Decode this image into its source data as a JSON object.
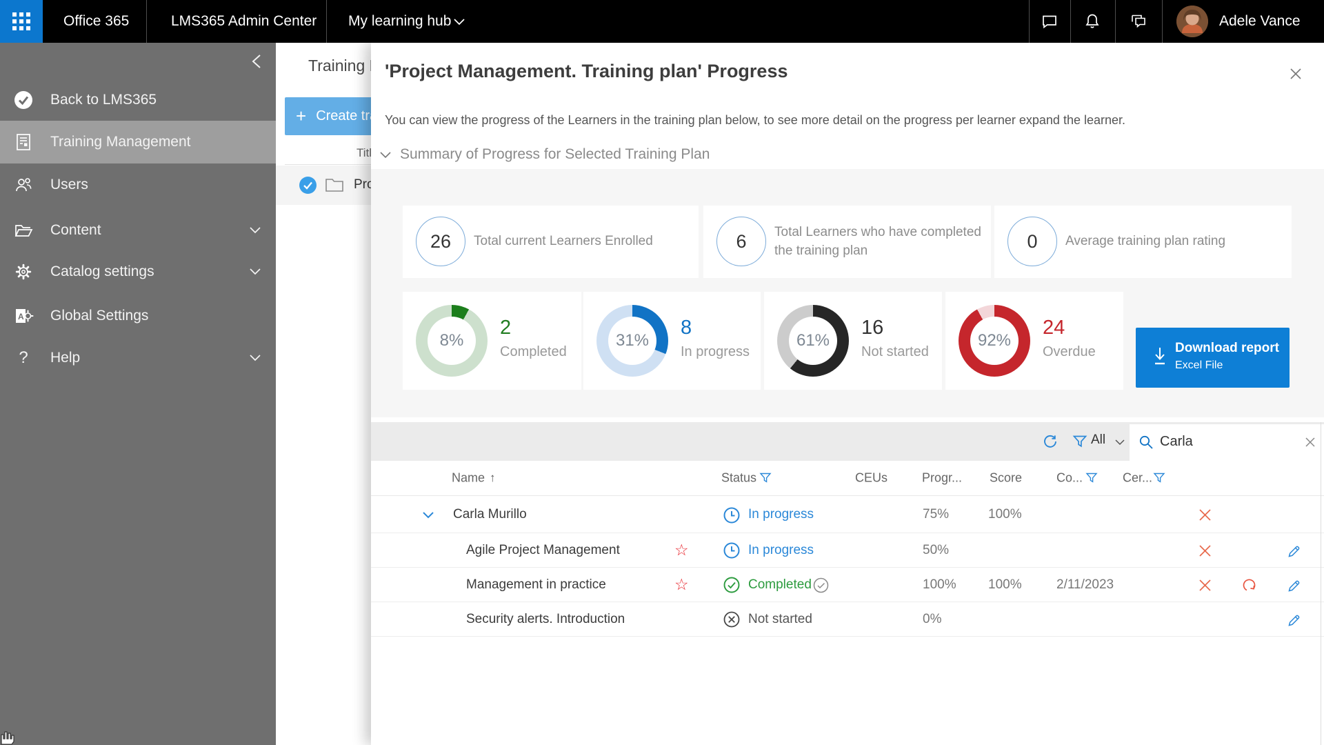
{
  "topbar": {
    "brand": "Office 365",
    "app": "LMS365 Admin Center",
    "hub": "My learning hub",
    "user": "Adele Vance"
  },
  "sidebar": {
    "items": [
      {
        "label": "Back to LMS365"
      },
      {
        "label": "Training Management"
      },
      {
        "label": "Users"
      },
      {
        "label": "Content"
      },
      {
        "label": "Catalog settings"
      },
      {
        "label": "Global Settings"
      },
      {
        "label": "Help"
      }
    ]
  },
  "background_page": {
    "title": "Training M",
    "create_button_plus": "+",
    "create_button": "Create tra",
    "column_header": "Titl",
    "row_label": "Pro"
  },
  "overlay": {
    "title": "'Project Management. Training plan' Progress",
    "description": "You can view the progress of the Learners in the training plan below, to see more detail on the progress per learner expand the learner.",
    "summary_heading": "Summary of Progress for Selected Training Plan",
    "stats": [
      {
        "value": "26",
        "label": "Total current Learners Enrolled"
      },
      {
        "value": "6",
        "label": "Total Learners who have completed the training plan"
      },
      {
        "value": "0",
        "label": "Average training plan rating"
      }
    ],
    "donuts": [
      {
        "pct": "8%",
        "pct_value": 8,
        "count": "2",
        "label": "Completed",
        "arc": "#1c7e1c",
        "track": "#cde0cd",
        "count_color": "#217d21"
      },
      {
        "pct": "31%",
        "pct_value": 31,
        "count": "8",
        "label": "In progress",
        "arc": "#1173c5",
        "track": "#cfe0f3",
        "count_color": "#1173c5"
      },
      {
        "pct": "61%",
        "pct_value": 61,
        "count": "16",
        "label": "Not started",
        "arc": "#262626",
        "track": "#cccccc",
        "count_color": "#333333"
      },
      {
        "pct": "92%",
        "pct_value": 92,
        "count": "24",
        "label": "Overdue",
        "arc": "#c5262c",
        "track": "#f3d6d9",
        "count_color": "#c5262c"
      }
    ],
    "download": {
      "title": "Download report",
      "subtitle": "Excel File"
    },
    "toolbar": {
      "filter_value": "All",
      "search_value": "Carla"
    },
    "table": {
      "columns": [
        "Name",
        "Status",
        "CEUs",
        "Progr...",
        "Score",
        "Co...",
        "Cer..."
      ],
      "sort_arrow": "↑",
      "rows": [
        {
          "name": "Carla Murillo",
          "status": "In progress",
          "progress": "75%",
          "score": "100%",
          "completion": ""
        },
        {
          "name": "Agile Project Management",
          "status": "In progress",
          "progress": "50%",
          "score": "",
          "completion": ""
        },
        {
          "name": "Management in practice",
          "status": "Completed",
          "progress": "100%",
          "score": "100%",
          "completion": "2/11/2023"
        },
        {
          "name": "Security alerts. Introduction",
          "status": "Not started",
          "progress": "0%",
          "score": "",
          "completion": ""
        }
      ]
    }
  }
}
